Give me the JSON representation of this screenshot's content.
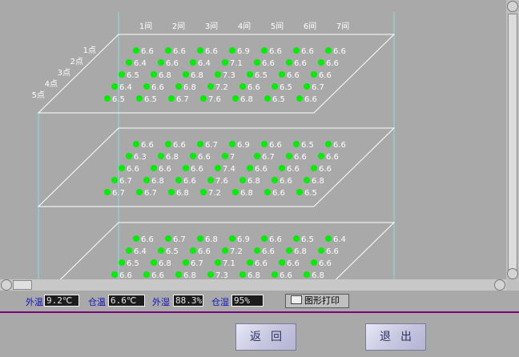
{
  "columns": [
    "1间",
    "2间",
    "3间",
    "4间",
    "5间",
    "6间",
    "7间"
  ],
  "points": [
    "1点",
    "2点",
    "3点",
    "4点",
    "5点"
  ],
  "layers": [
    [
      [
        "6.6",
        "6.6",
        "6.6",
        "6.9",
        "6.6",
        "6.6",
        "6.6"
      ],
      [
        "6.4",
        "6.6",
        "6.4",
        "7.1",
        "6.6",
        "6.6",
        "6.6"
      ],
      [
        "6.5",
        "6.8",
        "6.8",
        "7.3",
        "6.5",
        "6.6",
        "6.6"
      ],
      [
        "6.4",
        "6.6",
        "6.8",
        "7.2",
        "6.6",
        "6.5",
        "6.7"
      ],
      [
        "6.5",
        "6.5",
        "6.7",
        "7.6",
        "6.8",
        "6.5",
        "6.6"
      ]
    ],
    [
      [
        "6.6",
        "6.6",
        "6.7",
        "6.9",
        "6.6",
        "6.5",
        "6.6"
      ],
      [
        "6.3",
        "6.8",
        "6.6",
        "7",
        "6.7",
        "6.6",
        "6.6"
      ],
      [
        "6.6",
        "6.6",
        "6.6",
        "7.4",
        "6.6",
        "6.6",
        "6.6"
      ],
      [
        "6.7",
        "6.8",
        "6.6",
        "7.6",
        "6.8",
        "6.6",
        "6.8"
      ],
      [
        "6.7",
        "6.7",
        "6.8",
        "7.2",
        "6.8",
        "6.6",
        "6.5"
      ]
    ],
    [
      [
        "6.6",
        "6.7",
        "6.8",
        "6.9",
        "6.6",
        "6.5",
        "6.4"
      ],
      [
        "6.4",
        "6.5",
        "6.6",
        "7.2",
        "6.6",
        "6.8",
        "6.6"
      ],
      [
        "6.5",
        "6.8",
        "6.7",
        "7.1",
        "6.6",
        "6.6",
        "6.6"
      ],
      [
        "6.6",
        "6.6",
        "6.8",
        "7.3",
        "6.8",
        "6.6",
        "6.8"
      ]
    ]
  ],
  "bottom_bar": {
    "outside_temp_label": "外温",
    "outside_temp_value": "9.2℃",
    "silo_temp_label": "仓温",
    "silo_temp_value": "6.6℃",
    "outside_humidity_label": "外湿",
    "outside_humidity_value": "88.3%",
    "silo_humidity_label": "仓湿",
    "silo_humidity_value": "95%",
    "print_button": "图形打印"
  },
  "back_button": "返回",
  "exit_button": "退出",
  "colors": {
    "dot": "#00ee00",
    "grid": "#ffffff",
    "cyan_axis": "#7fe0e6",
    "label_blue": "#1010c0",
    "separator": "#800080"
  }
}
